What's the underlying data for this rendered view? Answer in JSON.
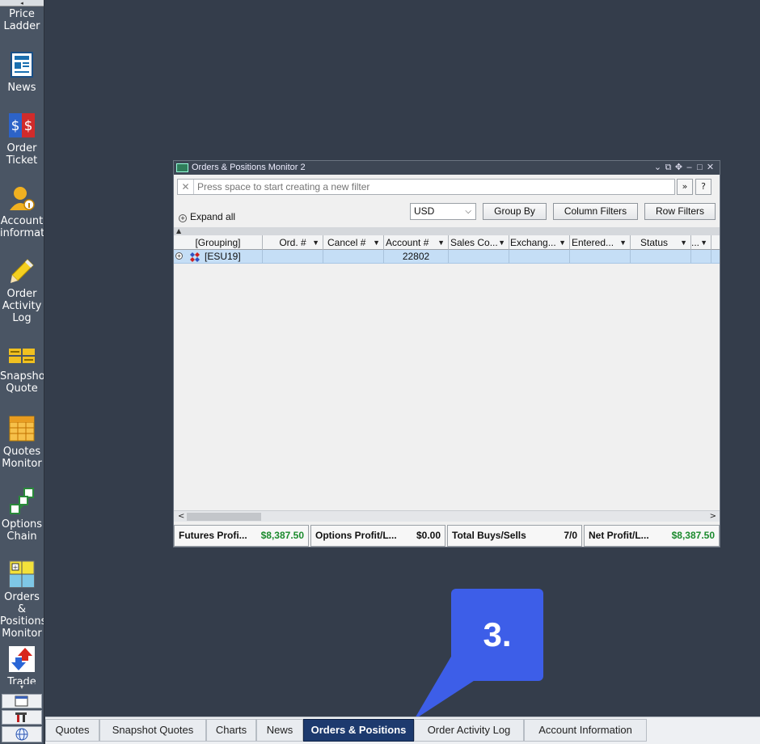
{
  "sidebar": {
    "items": [
      {
        "label": "Price\nLadder",
        "icon": "price-ladder-icon"
      },
      {
        "label": "News",
        "icon": "news-icon"
      },
      {
        "label": "Order\nTicket",
        "icon": "dollar-ticket-icon"
      },
      {
        "label": "Account\ninformat",
        "icon": "user-info-icon"
      },
      {
        "label": "Order\nActivity\nLog",
        "icon": "pencil-icon"
      },
      {
        "label": "Snapsho\nQuote",
        "icon": "snapshot-quote-icon"
      },
      {
        "label": "Quotes\nMonitor",
        "icon": "quotes-grid-icon"
      },
      {
        "label": "Options\nChain",
        "icon": "options-chain-icon"
      },
      {
        "label": "Orders &\nPositions\nMonitor",
        "icon": "orders-positions-icon"
      },
      {
        "label": "Trade",
        "icon": "trade-arrows-icon"
      }
    ]
  },
  "window": {
    "title": "Orders & Positions Monitor 2",
    "filter_placeholder": "Press space to start creating a new filter",
    "expand_all": "Expand all",
    "currency": "USD",
    "group_by": "Group By",
    "column_filters": "Column Filters",
    "row_filters": "Row Filters",
    "help": "?",
    "columns": [
      "[Grouping]",
      "Ord. #",
      "Cancel #",
      "Account #",
      "Sales Co...",
      "Exchang...",
      "Entered...",
      "Status",
      "..."
    ],
    "rows": [
      {
        "grouping": "[ESU19]",
        "account": "22802"
      }
    ],
    "totals": [
      {
        "label": "Futures Profi...",
        "value": "$8,387.50",
        "green": true
      },
      {
        "label": "Options Profit/L...",
        "value": "$0.00",
        "green": false
      },
      {
        "label": "Total Buys/Sells",
        "value": "7/0",
        "green": false
      },
      {
        "label": "Net Profit/L...",
        "value": "$8,387.50",
        "green": true
      }
    ]
  },
  "tabs": [
    "Quotes",
    "Snapshot Quotes",
    "Charts",
    "News",
    "Orders & Positions",
    "Order Activity Log",
    "Account Information"
  ],
  "active_tab": "Orders & Positions",
  "callout": "3.",
  "colors": {
    "accent": "#3d5ee8",
    "active_tab": "#1d3a6e",
    "profit_green": "#1b8a2d",
    "selected_row": "#c5def6"
  }
}
